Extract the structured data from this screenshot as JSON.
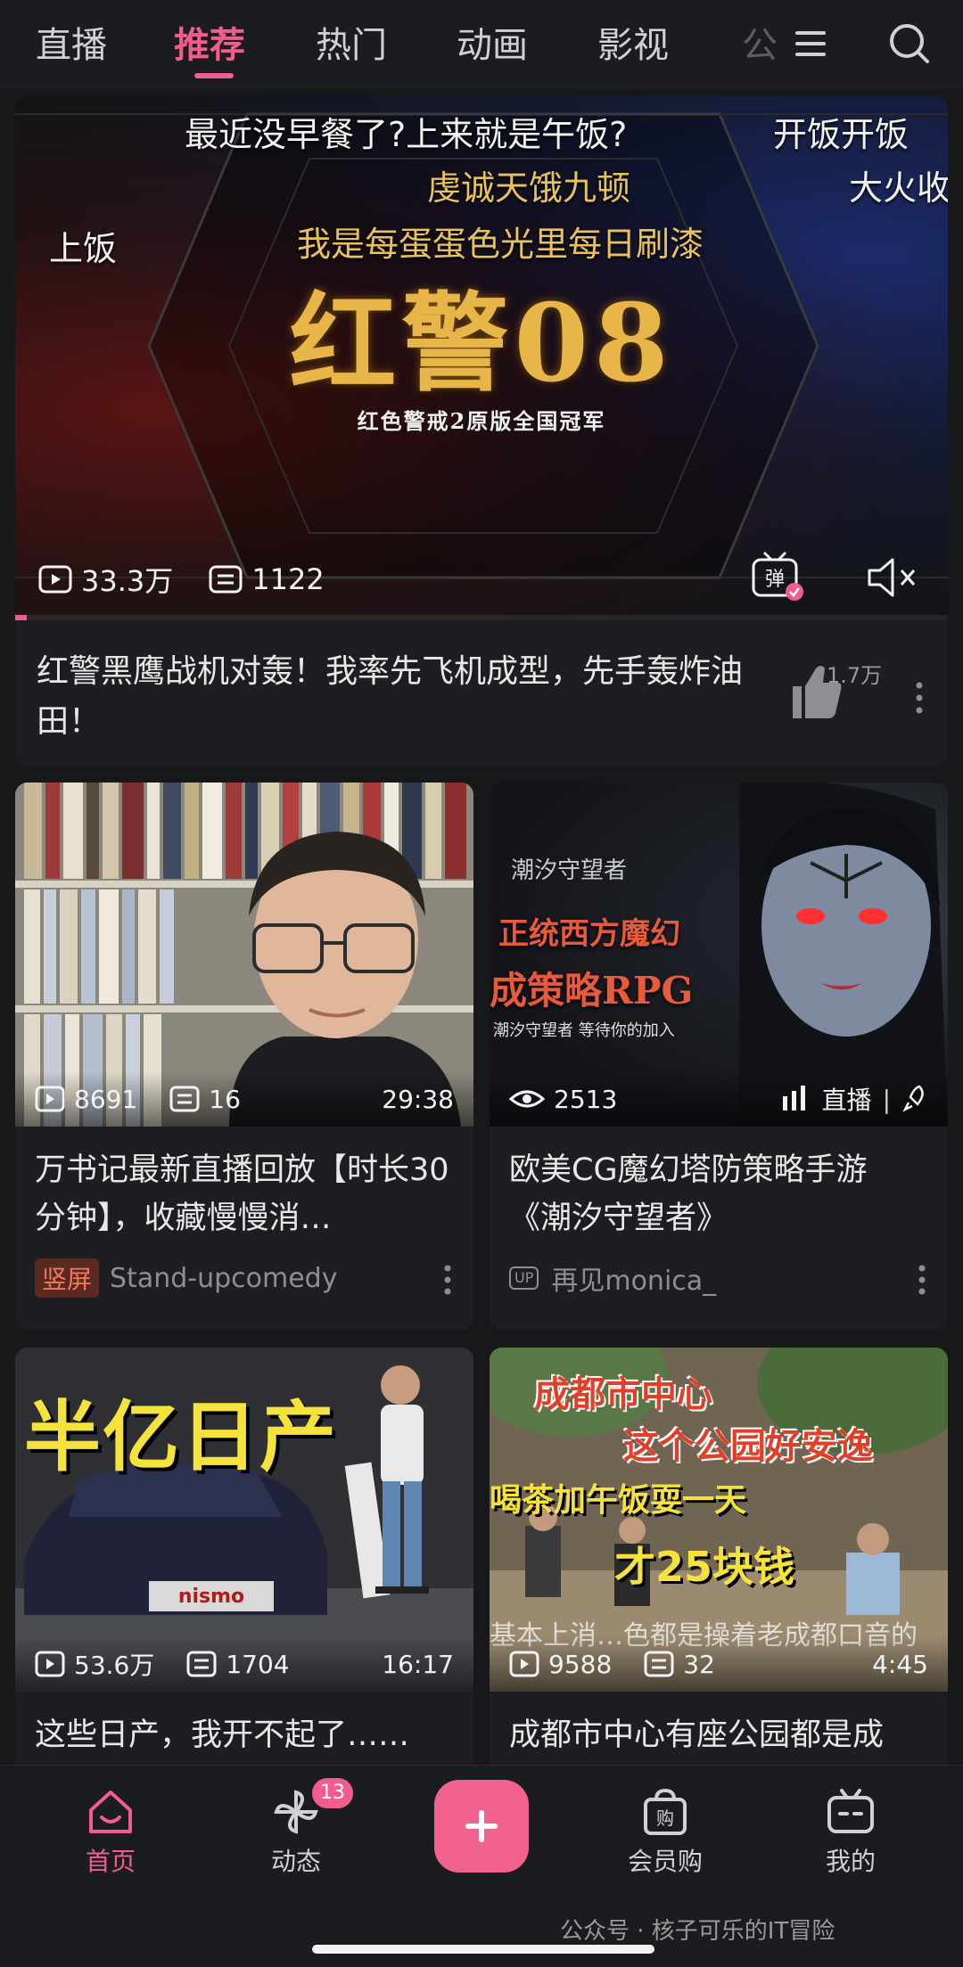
{
  "top_tabs": {
    "items": [
      "直播",
      "推荐",
      "热门",
      "动画",
      "影视",
      "公"
    ],
    "active_index": 1
  },
  "hero": {
    "danmaku": [
      "最近没早餐了?上来就是午饭?",
      "开饭开饭",
      "大火收",
      "上饭",
      "虔诚天饿九顿",
      "我是每蛋蛋色光里每日刷漆"
    ],
    "art_title": "红警08",
    "art_subtitle": "红色警戒2原版全国冠军",
    "views": "33.3万",
    "comments": "1122",
    "progress_fraction": 0.012,
    "title": "红警黑鹰战机对轰！我率先飞机成型，先手轰炸油田！",
    "likes": "1.7万"
  },
  "cards": [
    {
      "views": "8691",
      "comments": "16",
      "duration": "29:38",
      "title": "万书记最新直播回放【时长30分钟】，收藏慢慢消…",
      "badge": "竖屏",
      "author": "Stand-upcomedy"
    },
    {
      "overlay_line1": "潮汐守望者",
      "overlay_line2": "正统西方魔幻",
      "overlay_line3": "成策略RPG",
      "overlay_line4": "潮汐守望者 等待你的加入",
      "views": "2513",
      "live_label": "直播",
      "title": "欧美CG魔幻塔防策略手游《潮汐守望者》",
      "up_label": "UP",
      "author": "再见monica_"
    },
    {
      "overlay_text": "半亿日产",
      "plate": "nismo",
      "views": "53.6万",
      "comments": "1704",
      "duration": "16:17",
      "title": "这些日产，我开不起了……"
    },
    {
      "overlay_line1": "成都市中心",
      "overlay_line2": "这个公园好安逸",
      "overlay_line3": "喝茶加午饭耍一天",
      "overlay_line4": "才25块钱",
      "danmaku": "基本上消…色都是操着老成都口音的",
      "views": "9588",
      "comments": "32",
      "duration": "4:45",
      "title": "成都市中心有座公园都是成"
    }
  ],
  "bottom_nav": {
    "items": [
      "首页",
      "动态",
      "",
      "会员购",
      "我的"
    ],
    "badge": "13",
    "active_index": 0
  },
  "watermark": "公众号 · 核子可乐的IT冒险",
  "colors": {
    "accent": "#f25d8e",
    "background": "#17181a",
    "card": "#1d1e21"
  }
}
